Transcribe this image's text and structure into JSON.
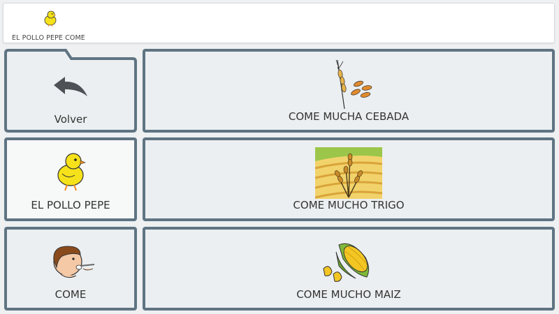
{
  "message_bar": {
    "items": [
      {
        "label": "EL POLLO PEPE COME",
        "icon": "chick-icon"
      }
    ]
  },
  "board": {
    "back": {
      "label": "Volver",
      "icon": "undo-arrow-icon"
    },
    "cells": [
      {
        "label": "EL POLLO PEPE",
        "icon": "chick-icon"
      },
      {
        "label": "COME",
        "icon": "boy-eating-icon"
      },
      {
        "label": "COME MUCHA CEBADA",
        "icon": "barley-icon"
      },
      {
        "label": "COME MUCHO TRIGO",
        "icon": "wheat-field-icon"
      },
      {
        "label": "COME MUCHO MAIZ",
        "icon": "corn-icon"
      }
    ]
  },
  "colors": {
    "cell_border": "#5f7483",
    "cell_bg": "#eceff1",
    "page_bg": "#eef0f1"
  }
}
